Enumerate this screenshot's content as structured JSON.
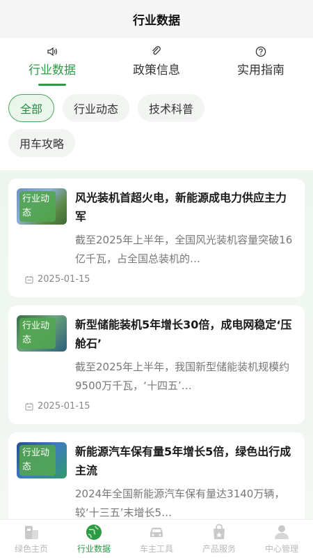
{
  "app": {
    "title": "行业数据"
  },
  "top_tabs": [
    {
      "label": "行业数据",
      "icon": "speaker-icon",
      "active": true
    },
    {
      "label": "政策信息",
      "icon": "paperclip-icon",
      "active": false
    },
    {
      "label": "实用指南",
      "icon": "question-icon",
      "active": false
    }
  ],
  "chips": [
    {
      "label": "全部",
      "active": true
    },
    {
      "label": "行业动态",
      "active": false
    },
    {
      "label": "技术科普",
      "active": false
    },
    {
      "label": "用车攻略",
      "active": false
    }
  ],
  "articles": [
    {
      "tag": "行业动态",
      "title": "风光装机首超火电，新能源成电力供应主力军",
      "summary": "截至2025年上半年，全国风光装机容量突破16亿千瓦，占全国总装机的…",
      "date": "2025-01-15"
    },
    {
      "tag": "行业动态",
      "title": "新型储能装机5年增长30倍，成电网稳定‘压舱石’",
      "summary": "截至2025年上半年，我国新型储能装机规模约9500万千瓦，‘十四五’…",
      "date": "2025-01-15"
    },
    {
      "tag": "行业动态",
      "title": "新能源汽车保有量5年增长5倍，绿色出行成主流",
      "summary": "2024年全国新能源汽车保有量达3140万辆，较‘十三五’末增长5…",
      "date": ""
    }
  ],
  "bottom_nav": [
    {
      "label": "绿色主页",
      "icon": "home-building-icon",
      "active": false
    },
    {
      "label": "行业数据",
      "icon": "globe-icon",
      "active": true
    },
    {
      "label": "车主工具",
      "icon": "car-icon",
      "active": false
    },
    {
      "label": "产品服务",
      "icon": "shopping-bag-icon",
      "active": false
    },
    {
      "label": "中心管理",
      "icon": "user-icon",
      "active": false
    }
  ],
  "colors": {
    "accent": "#2e9a44",
    "chip_active_bg": "#eaf6ec",
    "nav_inactive": "#b9b9b9"
  }
}
